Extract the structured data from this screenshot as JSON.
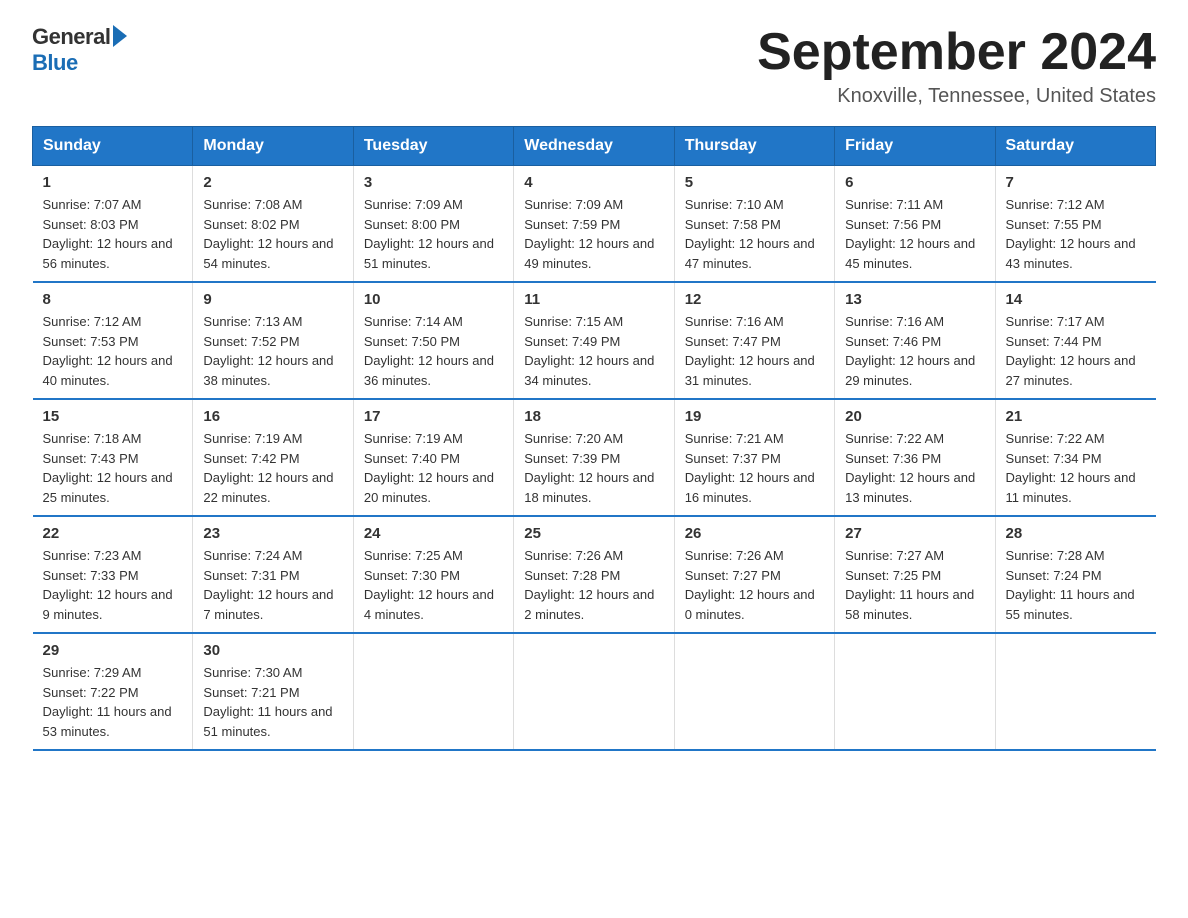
{
  "logo": {
    "text_general": "General",
    "text_blue": "Blue"
  },
  "header": {
    "month_year": "September 2024",
    "location": "Knoxville, Tennessee, United States"
  },
  "days_of_week": [
    "Sunday",
    "Monday",
    "Tuesday",
    "Wednesday",
    "Thursday",
    "Friday",
    "Saturday"
  ],
  "weeks": [
    [
      {
        "date": "1",
        "sunrise": "Sunrise: 7:07 AM",
        "sunset": "Sunset: 8:03 PM",
        "daylight": "Daylight: 12 hours and 56 minutes."
      },
      {
        "date": "2",
        "sunrise": "Sunrise: 7:08 AM",
        "sunset": "Sunset: 8:02 PM",
        "daylight": "Daylight: 12 hours and 54 minutes."
      },
      {
        "date": "3",
        "sunrise": "Sunrise: 7:09 AM",
        "sunset": "Sunset: 8:00 PM",
        "daylight": "Daylight: 12 hours and 51 minutes."
      },
      {
        "date": "4",
        "sunrise": "Sunrise: 7:09 AM",
        "sunset": "Sunset: 7:59 PM",
        "daylight": "Daylight: 12 hours and 49 minutes."
      },
      {
        "date": "5",
        "sunrise": "Sunrise: 7:10 AM",
        "sunset": "Sunset: 7:58 PM",
        "daylight": "Daylight: 12 hours and 47 minutes."
      },
      {
        "date": "6",
        "sunrise": "Sunrise: 7:11 AM",
        "sunset": "Sunset: 7:56 PM",
        "daylight": "Daylight: 12 hours and 45 minutes."
      },
      {
        "date": "7",
        "sunrise": "Sunrise: 7:12 AM",
        "sunset": "Sunset: 7:55 PM",
        "daylight": "Daylight: 12 hours and 43 minutes."
      }
    ],
    [
      {
        "date": "8",
        "sunrise": "Sunrise: 7:12 AM",
        "sunset": "Sunset: 7:53 PM",
        "daylight": "Daylight: 12 hours and 40 minutes."
      },
      {
        "date": "9",
        "sunrise": "Sunrise: 7:13 AM",
        "sunset": "Sunset: 7:52 PM",
        "daylight": "Daylight: 12 hours and 38 minutes."
      },
      {
        "date": "10",
        "sunrise": "Sunrise: 7:14 AM",
        "sunset": "Sunset: 7:50 PM",
        "daylight": "Daylight: 12 hours and 36 minutes."
      },
      {
        "date": "11",
        "sunrise": "Sunrise: 7:15 AM",
        "sunset": "Sunset: 7:49 PM",
        "daylight": "Daylight: 12 hours and 34 minutes."
      },
      {
        "date": "12",
        "sunrise": "Sunrise: 7:16 AM",
        "sunset": "Sunset: 7:47 PM",
        "daylight": "Daylight: 12 hours and 31 minutes."
      },
      {
        "date": "13",
        "sunrise": "Sunrise: 7:16 AM",
        "sunset": "Sunset: 7:46 PM",
        "daylight": "Daylight: 12 hours and 29 minutes."
      },
      {
        "date": "14",
        "sunrise": "Sunrise: 7:17 AM",
        "sunset": "Sunset: 7:44 PM",
        "daylight": "Daylight: 12 hours and 27 minutes."
      }
    ],
    [
      {
        "date": "15",
        "sunrise": "Sunrise: 7:18 AM",
        "sunset": "Sunset: 7:43 PM",
        "daylight": "Daylight: 12 hours and 25 minutes."
      },
      {
        "date": "16",
        "sunrise": "Sunrise: 7:19 AM",
        "sunset": "Sunset: 7:42 PM",
        "daylight": "Daylight: 12 hours and 22 minutes."
      },
      {
        "date": "17",
        "sunrise": "Sunrise: 7:19 AM",
        "sunset": "Sunset: 7:40 PM",
        "daylight": "Daylight: 12 hours and 20 minutes."
      },
      {
        "date": "18",
        "sunrise": "Sunrise: 7:20 AM",
        "sunset": "Sunset: 7:39 PM",
        "daylight": "Daylight: 12 hours and 18 minutes."
      },
      {
        "date": "19",
        "sunrise": "Sunrise: 7:21 AM",
        "sunset": "Sunset: 7:37 PM",
        "daylight": "Daylight: 12 hours and 16 minutes."
      },
      {
        "date": "20",
        "sunrise": "Sunrise: 7:22 AM",
        "sunset": "Sunset: 7:36 PM",
        "daylight": "Daylight: 12 hours and 13 minutes."
      },
      {
        "date": "21",
        "sunrise": "Sunrise: 7:22 AM",
        "sunset": "Sunset: 7:34 PM",
        "daylight": "Daylight: 12 hours and 11 minutes."
      }
    ],
    [
      {
        "date": "22",
        "sunrise": "Sunrise: 7:23 AM",
        "sunset": "Sunset: 7:33 PM",
        "daylight": "Daylight: 12 hours and 9 minutes."
      },
      {
        "date": "23",
        "sunrise": "Sunrise: 7:24 AM",
        "sunset": "Sunset: 7:31 PM",
        "daylight": "Daylight: 12 hours and 7 minutes."
      },
      {
        "date": "24",
        "sunrise": "Sunrise: 7:25 AM",
        "sunset": "Sunset: 7:30 PM",
        "daylight": "Daylight: 12 hours and 4 minutes."
      },
      {
        "date": "25",
        "sunrise": "Sunrise: 7:26 AM",
        "sunset": "Sunset: 7:28 PM",
        "daylight": "Daylight: 12 hours and 2 minutes."
      },
      {
        "date": "26",
        "sunrise": "Sunrise: 7:26 AM",
        "sunset": "Sunset: 7:27 PM",
        "daylight": "Daylight: 12 hours and 0 minutes."
      },
      {
        "date": "27",
        "sunrise": "Sunrise: 7:27 AM",
        "sunset": "Sunset: 7:25 PM",
        "daylight": "Daylight: 11 hours and 58 minutes."
      },
      {
        "date": "28",
        "sunrise": "Sunrise: 7:28 AM",
        "sunset": "Sunset: 7:24 PM",
        "daylight": "Daylight: 11 hours and 55 minutes."
      }
    ],
    [
      {
        "date": "29",
        "sunrise": "Sunrise: 7:29 AM",
        "sunset": "Sunset: 7:22 PM",
        "daylight": "Daylight: 11 hours and 53 minutes."
      },
      {
        "date": "30",
        "sunrise": "Sunrise: 7:30 AM",
        "sunset": "Sunset: 7:21 PM",
        "daylight": "Daylight: 11 hours and 51 minutes."
      },
      null,
      null,
      null,
      null,
      null
    ]
  ]
}
